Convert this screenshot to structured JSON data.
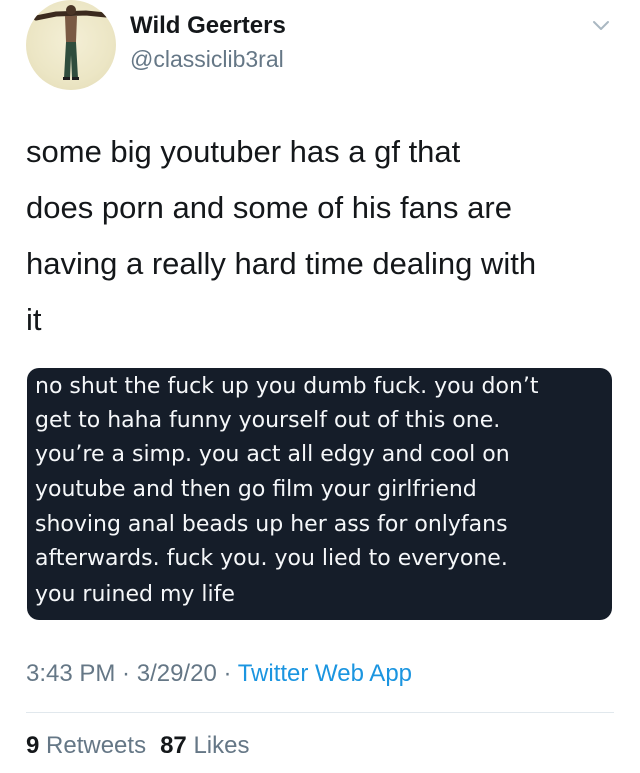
{
  "author": {
    "display_name": "Wild Geerters",
    "handle": "@classiclib3ral",
    "avatar_icon": "avatar-image",
    "menu_icon": "chevron-down-icon"
  },
  "tweet": {
    "text_lines": [
      "some big youtuber has a gf that",
      "does porn and some of his fans are",
      "having a really hard time dealing with",
      "it"
    ]
  },
  "attachment": {
    "lines": [
      "no shut the fuck up you dumb fuck. you don’t",
      "get to haha funny yourself out of this one.",
      "you’re a simp. you act all edgy and cool on",
      "youtube and then go film your girlfriend",
      "shoving anal beads up her ass for onlyfans",
      "afterwards. fuck you.  you lied to everyone.",
      "you ruined my life"
    ]
  },
  "meta": {
    "time": "3:43 PM",
    "separator": " · ",
    "date": "3/29/20",
    "source": "Twitter Web App"
  },
  "stats": {
    "retweets_count": "9",
    "retweets_label": "Retweets",
    "likes_count": "87",
    "likes_label": "Likes"
  },
  "colors": {
    "text": "#14171a",
    "secondary": "#657786",
    "link": "#1b95e0",
    "card_bg": "#151d29"
  }
}
